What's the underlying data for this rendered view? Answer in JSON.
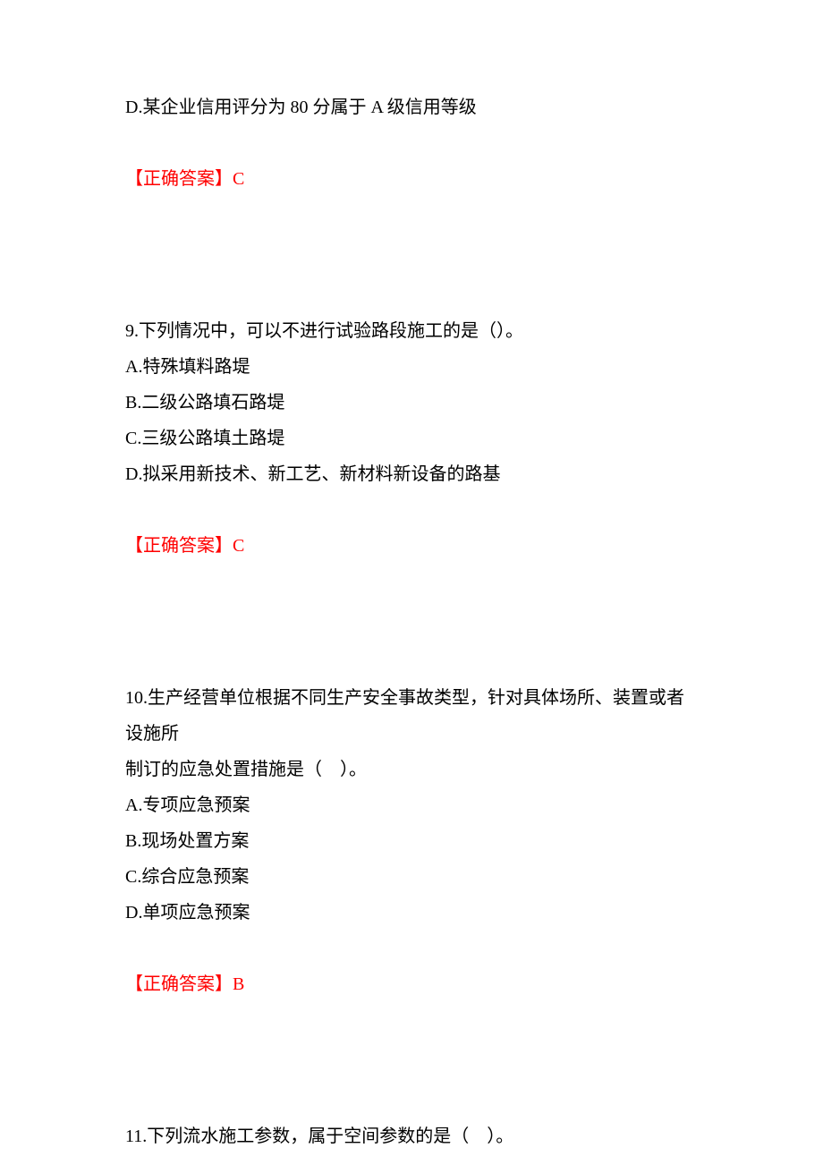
{
  "q8": {
    "optionD": "D.某企业信用评分为 80 分属于 A 级信用等级",
    "answerLabel": "【正确答案】",
    "answerValue": "C"
  },
  "q9": {
    "stem": "9.下列情况中，可以不进行试验路段施工的是（）。",
    "optionA": "A.特殊填料路堤",
    "optionB": "B.二级公路填石路堤",
    "optionC": "C.三级公路填土路堤",
    "optionD": "D.拟采用新技术、新工艺、新材料新设备的路基",
    "answerLabel": "【正确答案】",
    "answerValue": "C"
  },
  "q10": {
    "stem1": "10.生产经营单位根据不同生产安全事故类型，针对具体场所、装置或者设施所",
    "stem2": "制订的应急处置措施是（　）。",
    "optionA": "A.专项应急预案",
    "optionB": "B.现场处置方案",
    "optionC": "C.综合应急预案",
    "optionD": "D.单项应急预案",
    "answerLabel": "【正确答案】",
    "answerValue": "B"
  },
  "q11": {
    "stem": "11.下列流水施工参数，属于空间参数的是（　）。"
  }
}
